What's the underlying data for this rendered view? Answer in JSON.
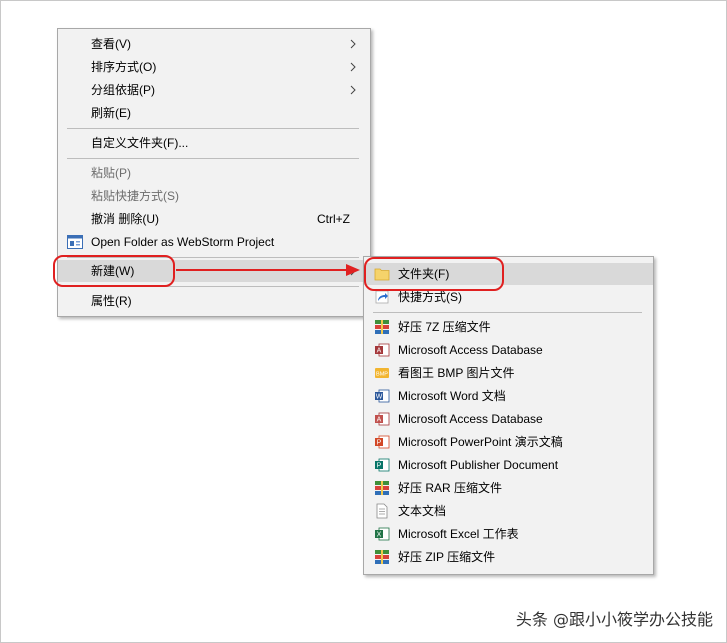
{
  "main_menu": {
    "items": [
      {
        "label": "查看(V)"
      },
      {
        "label": "排序方式(O)"
      },
      {
        "label": "分组依据(P)"
      },
      {
        "label": "刷新(E)"
      },
      {
        "label": "自定义文件夹(F)..."
      },
      {
        "label": "粘贴(P)"
      },
      {
        "label": "粘贴快捷方式(S)"
      },
      {
        "label": "撤消 删除(U)",
        "shortcut": "Ctrl+Z"
      },
      {
        "label": "Open Folder as WebStorm Project"
      },
      {
        "label": "新建(W)"
      },
      {
        "label": "属性(R)"
      }
    ]
  },
  "sub_menu": {
    "items": [
      {
        "label": "文件夹(F)",
        "icon": "folder-icon"
      },
      {
        "label": "快捷方式(S)",
        "icon": "shortcut-icon"
      },
      {
        "label": "好压 7Z 压缩文件",
        "icon": "archive-icon"
      },
      {
        "label": "Microsoft Access Database",
        "icon": "access-icon"
      },
      {
        "label": "看图王 BMP 图片文件",
        "icon": "bmp-icon"
      },
      {
        "label": "Microsoft Word 文档",
        "icon": "word-icon"
      },
      {
        "label": "Microsoft Access Database",
        "icon": "access-icon"
      },
      {
        "label": "Microsoft PowerPoint 演示文稿",
        "icon": "powerpoint-icon"
      },
      {
        "label": "Microsoft Publisher Document",
        "icon": "publisher-icon"
      },
      {
        "label": "好压 RAR 压缩文件",
        "icon": "archive-icon"
      },
      {
        "label": "文本文档",
        "icon": "text-document-icon"
      },
      {
        "label": "Microsoft Excel 工作表",
        "icon": "excel-icon"
      },
      {
        "label": "好压 ZIP 压缩文件",
        "icon": "archive-icon"
      }
    ]
  },
  "watermark": "头条 @跟小小筱学办公技能",
  "colors": {
    "callout": "#e02020",
    "menu_bg": "#f2f2f2",
    "highlight": "#d9d9d9"
  }
}
